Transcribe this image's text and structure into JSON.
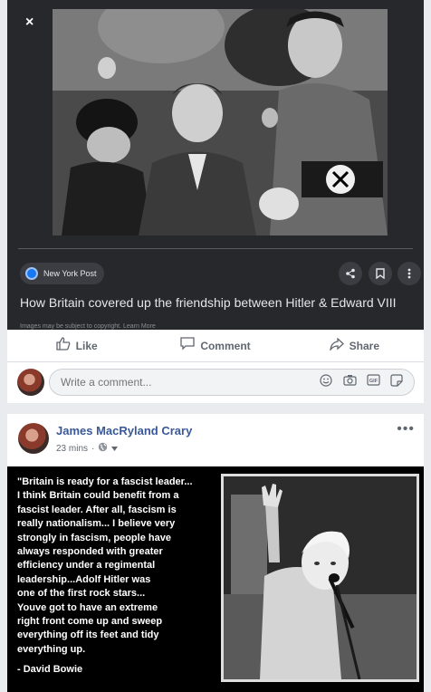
{
  "shared_card": {
    "close_label": "×",
    "source_name": "New York Post",
    "title": "How Britain covered up the friendship between Hitler & Edward VIII",
    "copyright": "Images may be subject to copyright. Learn More",
    "share_icon": "share-icon",
    "save_icon": "bookmark-icon",
    "more_icon": "more-vertical-icon"
  },
  "actions": {
    "like_label": "Like",
    "comment_label": "Comment",
    "share_label": "Share"
  },
  "comment_input": {
    "placeholder": "Write a comment...",
    "icons": [
      "emoji-icon",
      "camera-icon",
      "gif-icon",
      "sticker-icon"
    ]
  },
  "post": {
    "author": "James MacRyland Crary",
    "time": "23 mins",
    "separator": "·",
    "privacy_icon": "globe-icon",
    "more_label": "•••",
    "quote": "\"Britain is ready for a fascist leader...\nI think Britain could benefit from a\nfascist leader. After all, fascism is\nreally nationalism... I believe very\nstrongly in fascism, people have\nalways responded with greater\nefficiency under a regimental\nleadership...Adolf Hitler was\none of the first rock stars...\nYouve got to have an extreme\nright front come up and sweep\neverything off its feet and tidy\neverything up.",
    "attribution": "- David Bowie"
  },
  "colors": {
    "page_bg": "#e9ebee",
    "preview_bg": "#26282c",
    "link_blue": "#385898",
    "icon_grey": "#606770"
  }
}
